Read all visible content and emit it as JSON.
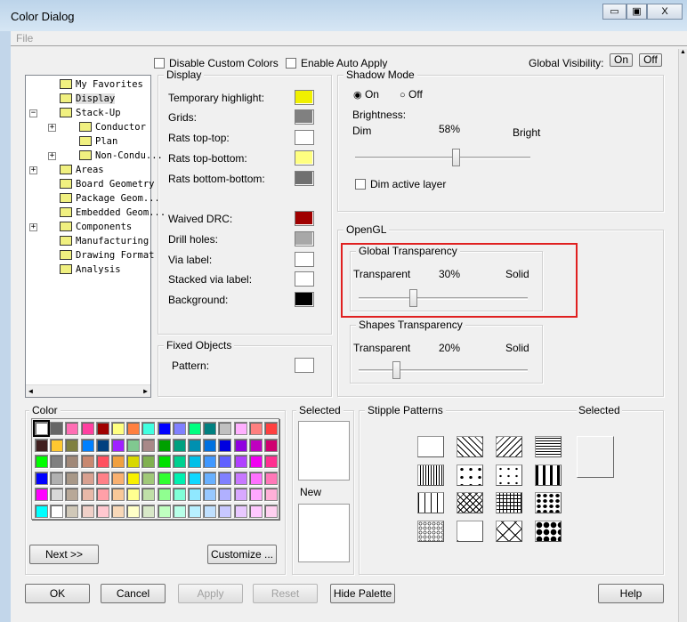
{
  "window": {
    "title": "Color Dialog",
    "minimize": "▭",
    "maximize": "▣",
    "close": "X"
  },
  "menu": {
    "file": "File"
  },
  "top": {
    "disable_custom": "Disable Custom Colors",
    "auto_apply": "Enable Auto Apply",
    "global_visibility": "Global Visibility:",
    "on": "On",
    "off": "Off"
  },
  "tree": [
    {
      "label": "My Favorites",
      "level": 0,
      "exp": ""
    },
    {
      "label": "Display",
      "level": 0,
      "exp": "",
      "selected": true
    },
    {
      "label": "Stack-Up",
      "level": 0,
      "exp": "−"
    },
    {
      "label": "Conductor",
      "level": 1,
      "exp": "+"
    },
    {
      "label": "Plan",
      "level": 1,
      "exp": ""
    },
    {
      "label": "Non-Condu...",
      "level": 1,
      "exp": "+"
    },
    {
      "label": "Areas",
      "level": 0,
      "exp": "+"
    },
    {
      "label": "Board Geometry",
      "level": 0,
      "exp": ""
    },
    {
      "label": "Package Geom...",
      "level": 0,
      "exp": ""
    },
    {
      "label": "Embedded Geom...",
      "level": 0,
      "exp": ""
    },
    {
      "label": "Components",
      "level": 0,
      "exp": "+"
    },
    {
      "label": "Manufacturing",
      "level": 0,
      "exp": ""
    },
    {
      "label": "Drawing Format",
      "level": 0,
      "exp": ""
    },
    {
      "label": "Analysis",
      "level": 0,
      "exp": ""
    }
  ],
  "display": {
    "title": "Display",
    "items": [
      {
        "label": "Temporary highlight:",
        "color": "#f0f000"
      },
      {
        "label": "Grids:",
        "color": "#808080"
      },
      {
        "label": "Rats top-top:",
        "color": "#ffffff"
      },
      {
        "label": "Rats top-bottom:",
        "color": "#ffff80"
      },
      {
        "label": "Rats bottom-bottom:",
        "color": "#707070"
      },
      {
        "label": "Waived DRC:",
        "color": "#a00000"
      },
      {
        "label": "Drill holes:",
        "color": "#a8a8a8"
      },
      {
        "label": "Via label:",
        "color": "#ffffff"
      },
      {
        "label": "Stacked via label:",
        "color": "#ffffff"
      },
      {
        "label": "Background:",
        "color": "#000000"
      }
    ]
  },
  "fixed": {
    "title": "Fixed Objects",
    "pattern_label": "Pattern:",
    "pattern_color": "#ffffff"
  },
  "shadow": {
    "title": "Shadow Mode",
    "on": "On",
    "off": "Off",
    "mode": "On",
    "brightness": "Brightness:",
    "dim": "Dim",
    "value": "58%",
    "bright": "Bright",
    "level": 0.58,
    "dim_active": "Dim active layer"
  },
  "opengl": {
    "title": "OpenGL",
    "global": {
      "title": "Global Transparency",
      "left": "Transparent",
      "value": "30%",
      "right": "Solid",
      "level": 0.3
    },
    "shapes": {
      "title": "Shapes Transparency",
      "left": "Transparent",
      "value": "20%",
      "right": "Solid",
      "level": 0.2
    }
  },
  "color": {
    "title": "Color",
    "next": "Next >>",
    "customize": "Customize ...",
    "palette": [
      "#ffffff",
      "#666666",
      "#ff6eb4",
      "#ff40a0",
      "#a00000",
      "#ffff80",
      "#ff8040",
      "#40ffe0",
      "#0000ff",
      "#8080ff",
      "#00ff80",
      "#008080",
      "#c0c0c0",
      "#ffb0ff",
      "#ff8080",
      "#ff4040",
      "#402020",
      "#ffc830",
      "#808040",
      "#0080ff",
      "#004080",
      "#a020ff",
      "#80c890",
      "#a88888",
      "#00a000",
      "#00a080",
      "#0090b0",
      "#0070e0",
      "#0000e0",
      "#9000e0",
      "#c000c0",
      "#d00070",
      "#00ff00",
      "#808080",
      "#a08878",
      "#c88870",
      "#ff5060",
      "#f0a040",
      "#d8d800",
      "#80b050",
      "#00e000",
      "#00d090",
      "#00c0e8",
      "#4098ff",
      "#6060ff",
      "#b040ff",
      "#f000f0",
      "#ff3090",
      "#0000ff",
      "#b0b0b0",
      "#a89888",
      "#d8a090",
      "#ff8088",
      "#f8b070",
      "#f8f000",
      "#a0c878",
      "#30ff30",
      "#00f0b0",
      "#10d8ff",
      "#68b0ff",
      "#8080ff",
      "#c878ff",
      "#ff70ff",
      "#ff78b8",
      "#ff00ff",
      "#d8d8d8",
      "#b8a898",
      "#e8b8a8",
      "#ffa0a8",
      "#f8c898",
      "#ffff90",
      "#c0e0a8",
      "#90ff90",
      "#80ffd8",
      "#90e8ff",
      "#98c8ff",
      "#b0b0ff",
      "#d8a8ff",
      "#ffa8ff",
      "#ffb0d8",
      "#00ffff",
      "#ffffff",
      "#d0c8b8",
      "#f0d0c8",
      "#ffc8d0",
      "#f8d8b8",
      "#ffffc8",
      "#d8e8c8",
      "#c0ffc0",
      "#b8ffe8",
      "#b8f0ff",
      "#c0e0ff",
      "#c8c8ff",
      "#e8c8ff",
      "#ffc8ff",
      "#ffd0f0"
    ]
  },
  "selected": {
    "title": "Selected",
    "new": "New"
  },
  "stipple": {
    "title": "Stipple Patterns",
    "selected": "Selected",
    "patterns": [
      "solid",
      "diag-back",
      "diag-fwd",
      "horizontal",
      "vertical",
      "triangles",
      "plus",
      "dashes",
      "ticks",
      "crosshatch-diag",
      "grid",
      "dots-large",
      "circles",
      "octagon",
      "x-diamond",
      "diamonds"
    ]
  },
  "buttons": {
    "ok": "OK",
    "cancel": "Cancel",
    "apply": "Apply",
    "reset": "Reset",
    "hide_palette": "Hide Palette",
    "help": "Help"
  }
}
